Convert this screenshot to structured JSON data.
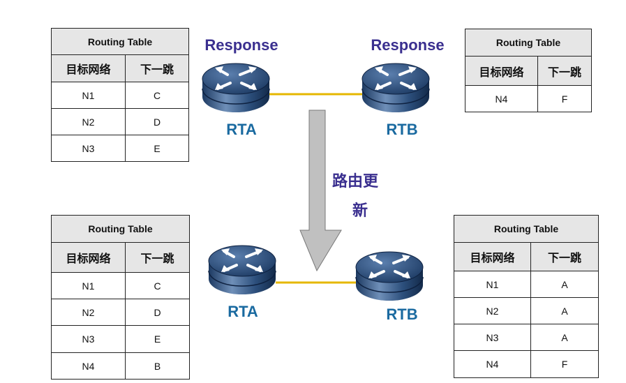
{
  "colors": {
    "link": "#e5b700",
    "router": "#2c4f7c",
    "response": "#3a2f8f",
    "router_label": "#1a6aa0",
    "header_bg": "#e6e6e6",
    "arrow": "#c0c0c0"
  },
  "labels": {
    "response_a": "Response",
    "response_b": "Response",
    "rta_top": "RTA",
    "rtb_top": "RTB",
    "rta_bottom": "RTA",
    "rtb_bottom": "RTB",
    "update_line1": "路由更",
    "update_line2": "新"
  },
  "tables": {
    "top_left": {
      "title": "Routing Table",
      "headers": [
        "目标网络",
        "下一跳"
      ],
      "rows": [
        [
          "N1",
          "C"
        ],
        [
          "N2",
          "D"
        ],
        [
          "N3",
          "E"
        ]
      ]
    },
    "top_right": {
      "title": "Routing Table",
      "headers": [
        "目标网络",
        "下一跳"
      ],
      "rows": [
        [
          "N4",
          "F"
        ]
      ]
    },
    "bottom_left": {
      "title": "Routing Table",
      "headers": [
        "目标网络",
        "下一跳"
      ],
      "rows": [
        [
          "N1",
          "C"
        ],
        [
          "N2",
          "D"
        ],
        [
          "N3",
          "E"
        ],
        [
          "N4",
          "B"
        ]
      ]
    },
    "bottom_right": {
      "title": "Routing Table",
      "headers": [
        "目标网络",
        "下一跳"
      ],
      "rows": [
        [
          "N1",
          "A"
        ],
        [
          "N2",
          "A"
        ],
        [
          "N3",
          "A"
        ],
        [
          "N4",
          "F"
        ]
      ]
    }
  }
}
